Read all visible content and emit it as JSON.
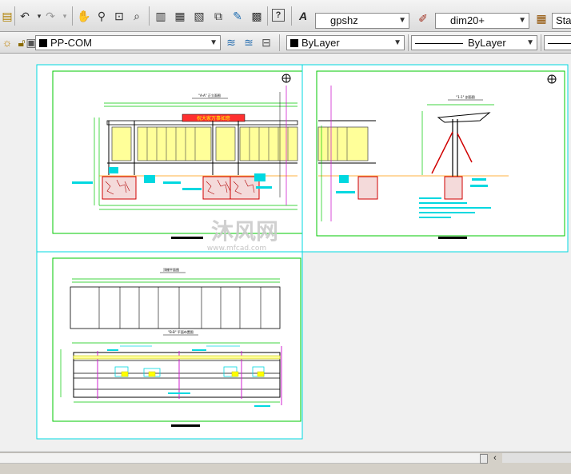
{
  "toolbar_top": {
    "text_style": "gpshz",
    "dim_style": "dim20+",
    "table_style": "Sta"
  },
  "toolbar_layers": {
    "current_layer": "PP-COM",
    "color": "ByLayer",
    "linetype": "ByLayer"
  },
  "drawing": {
    "watermark_main": "沐风网",
    "watermark_url": "www.mfcad.com",
    "sign_text": "祝大家万事如意",
    "sheet1_title": "\"A-A\" 正立面图",
    "sheet2_title": "\"1-1\" 剖面图",
    "sheet3_title_top": "顶棚平面图",
    "sheet3_title_bottom": "\"B-B\" 平面布置图"
  },
  "colors": {
    "accent_green": "#00c800",
    "accent_cyan": "#00d8e0",
    "window_yellow": "#ffff99",
    "stone_red": "#d00000"
  }
}
